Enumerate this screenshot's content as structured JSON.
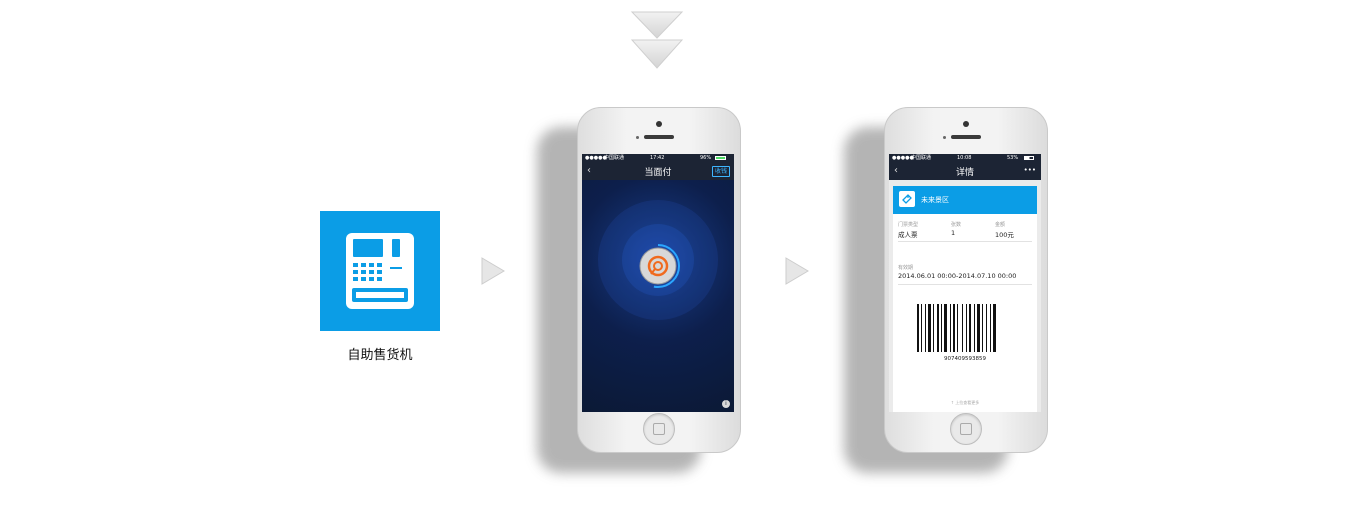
{
  "vending_machine": {
    "label": "自助售货机"
  },
  "phone_pay": {
    "status": {
      "carrier": "中国联通",
      "time": "17:42",
      "battery": "96%"
    },
    "nav_title": "当面付",
    "collect_button": "收钱"
  },
  "phone_detail": {
    "status": {
      "carrier": "中国联通",
      "time": "10:08",
      "battery": "53%"
    },
    "nav_title": "详情",
    "more": "•••",
    "venue_name": "未来景区",
    "ticket_type_label": "门票类型",
    "ticket_type_value": "成人票",
    "count_label": "张数",
    "count_value": "1",
    "amount_label": "金额",
    "amount_value": "100元",
    "validity_label": "有效期",
    "validity_value": "2014.06.01 00:00-2014.07.10 00:00",
    "barcode_number": "907409593859",
    "footer_hint": "↑ 上拉查看更多"
  },
  "colors": {
    "accent_blue": "#0b9de6",
    "nav_dark": "#1c2434",
    "pay_bg": "#0d1f4c"
  }
}
